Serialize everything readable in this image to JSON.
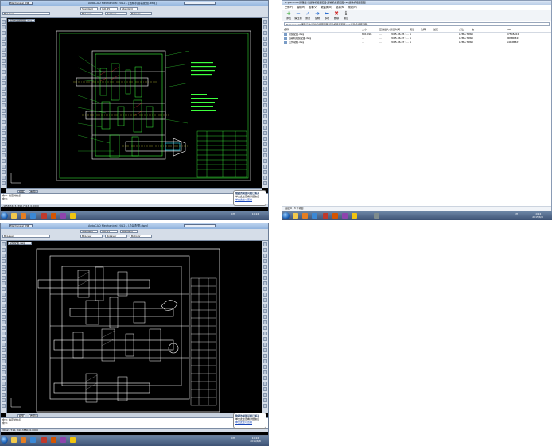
{
  "top_cad": {
    "window_title": "AutoCAD Mechanical 2012 - [运输机组装配图.dwg]",
    "workspace": "Mechanical 经典",
    "tab_labels": [
      "运输机组装配图.dwg"
    ],
    "toolbar_values": [
      "ByLayer",
      "ByLayer",
      "ByLayer",
      "ByColor",
      "Standard",
      "Standard",
      "ISO-25"
    ],
    "layout_tabs": [
      "模型",
      "布局1"
    ],
    "command_line": [
      "命令: 指定对角点:",
      "命令:"
    ],
    "status_text": "-1658.3423, 398.7016, 0.0000",
    "balloon_title": "隐藏的局部问题已解决",
    "balloon_text": "单击此处查看详细信息",
    "balloon_link": "单击此处以查看"
  },
  "bottom_cad": {
    "window_title": "AutoCAD Mechanical 2012 - [总装配图.dwg]",
    "workspace": "Mechanical 经典",
    "tab_labels": [
      "总装配图.dwg"
    ],
    "toolbar_values": [
      "ByLayer",
      "ByLayer",
      "ByLayer",
      "ByColor",
      "Standard",
      "Standard",
      "ISO-25"
    ],
    "layout_tabs": [
      "模型",
      "布局1"
    ],
    "command_line": [
      "命令: 指定对角点:",
      "命令:"
    ],
    "status_text": "3052.7710, 241.3880, 0.0000",
    "balloon_title": "隐藏的局部问题已解决",
    "balloon_text": "单击此处查看详细信息",
    "balloon_link": "单击此处以查看"
  },
  "explorer": {
    "title": "D:\\personal\\课程设计\\运输机组装配图\\运输机组装配图.rar\\运输机组装配图",
    "menu": [
      "文件(F)",
      "编辑(E)",
      "查看(V)",
      "收藏夹(O)",
      "选项(N)",
      "帮助(H)"
    ],
    "tools": [
      {
        "label": "添加",
        "icon": "plus-icon",
        "color": "#2aa52a"
      },
      {
        "label": "解压到",
        "icon": "minus-icon",
        "color": "#2c6fd1"
      },
      {
        "label": "测试",
        "icon": "check-icon",
        "color": "#2c6fd1"
      },
      {
        "label": "复制",
        "icon": "arrow-right-icon",
        "color": "#2c6fd1"
      },
      {
        "label": "移动",
        "icon": "arrow-left-icon",
        "color": "#2c6fd1"
      },
      {
        "label": "删除",
        "icon": "cross-icon",
        "color": "#d12c2c"
      },
      {
        "label": "信息",
        "icon": "info-icon",
        "color": "#555555"
      }
    ],
    "address": "D:\\personal\\课程设计\\运输机组装配图\\运输机组装配图.rar\\运输机组装配图\\",
    "columns": [
      "名称",
      "大小",
      "压缩后大小",
      "修改时间",
      "属性",
      "注释",
      "加密",
      "方法",
      "块",
      "CRC"
    ],
    "files": [
      {
        "name": "总装配图.dwg",
        "size": "891 096",
        "packed": "...",
        "modified": "2015-06-05 1...",
        "attr": "A",
        "method": "LZMA:768k",
        "block": "0",
        "crc": "07F08A52"
      },
      {
        "name": "运输机组装配图.dwg",
        "size": "...",
        "packed": "...",
        "modified": "2015-06-07 1...",
        "attr": "A",
        "method": "LZMA:768k",
        "block": "0",
        "crc": "3DFBD841"
      },
      {
        "name": "主传动箱.dwg",
        "size": "...",
        "packed": "...",
        "modified": "2015-06-07 1...",
        "attr": "A",
        "method": "LZMA:768k",
        "block": "0",
        "crc": "A4D2BB27"
      }
    ],
    "status": "选定 0 / 3 个项目"
  },
  "taskbars": {
    "clock_time": "10:24",
    "clock_date": "2015/6/8",
    "lang": "CH"
  },
  "colors": {
    "cad_green": "#3dff3d",
    "cad_white": "#ffffff",
    "cad_cyan": "#20e0ff",
    "taskbar": "#3d5274"
  }
}
